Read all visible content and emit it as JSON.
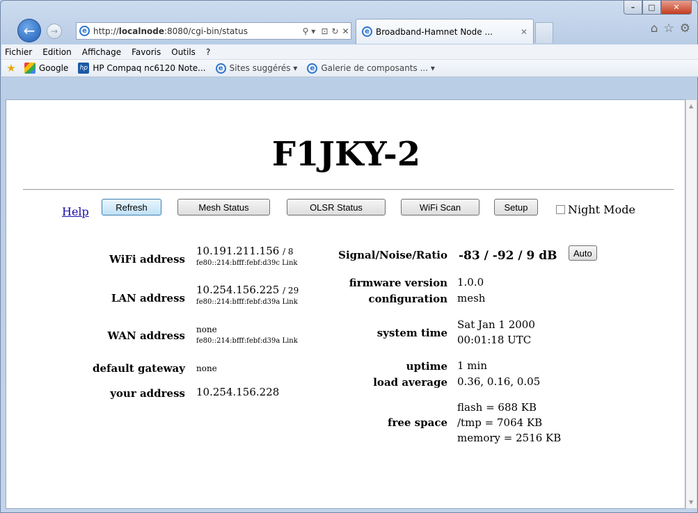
{
  "window": {
    "minimize_label": "–",
    "maximize_label": "□",
    "close_label": "✕"
  },
  "browser": {
    "url_prefix": "http://",
    "url_host": "localnode",
    "url_rest": ":8080/cgi-bin/status",
    "address_buttons": [
      "⚲ ▾",
      "⊡",
      "↻",
      "✕"
    ],
    "tab_title": "Broadband-Hamnet Node ...",
    "tab_close": "✕",
    "nav_icons": [
      "⌂",
      "☆",
      "⚙"
    ],
    "menu": [
      "Fichier",
      "Edition",
      "Affichage",
      "Favoris",
      "Outils",
      "?"
    ],
    "favorites": [
      {
        "label": "Google",
        "icon": "google-icon"
      },
      {
        "label": "HP Compaq nc6120 Note...",
        "icon": "hp-icon"
      },
      {
        "label": "Sites suggérés ▾",
        "icon": "ie-icon"
      },
      {
        "label": "Galerie de composants ... ▾",
        "icon": "ie-icon"
      }
    ]
  },
  "page": {
    "title": "F1JKY-2",
    "help_link": "Help",
    "buttons": {
      "refresh": "Refresh",
      "mesh_status": "Mesh Status",
      "olsr_status": "OLSR Status",
      "wifi_scan": "WiFi Scan",
      "setup": "Setup",
      "auto": "Auto"
    },
    "night_mode_label": "Night Mode",
    "night_mode_checked": false,
    "left": {
      "wifi_label": "WiFi address",
      "wifi_ip": "10.191.211.156",
      "wifi_mask": "/ 8",
      "wifi_ipv6": "fe80::214:bfff:febf:d39c Link",
      "lan_label": "LAN address",
      "lan_ip": "10.254.156.225",
      "lan_mask": "/ 29",
      "lan_ipv6": "fe80::214:bfff:febf:d39a Link",
      "wan_label": "WAN address",
      "wan_ip": "none",
      "wan_ipv6": "fe80::214:bfff:febf:d39a Link",
      "gateway_label": "default gateway",
      "gateway_value": "none",
      "your_address_label": "your address",
      "your_address_value": "10.254.156.228"
    },
    "right": {
      "snr_label": "Signal/Noise/Ratio",
      "snr_value": "-83 / -92 / 9 dB",
      "firmware_label": "firmware version",
      "firmware_value": "1.0.0",
      "config_label": "configuration",
      "config_value": "mesh",
      "time_label": "system time",
      "time_line1": "Sat Jan 1 2000",
      "time_line2": "00:01:18 UTC",
      "uptime_label": "uptime",
      "uptime_value": "1 min",
      "load_label": "load average",
      "load_value": "0.36, 0.16, 0.05",
      "free_label": "free space",
      "free_flash": "flash = 688 KB",
      "free_tmp": "/tmp = 7064 KB",
      "free_memory": "memory = 2516 KB"
    }
  }
}
